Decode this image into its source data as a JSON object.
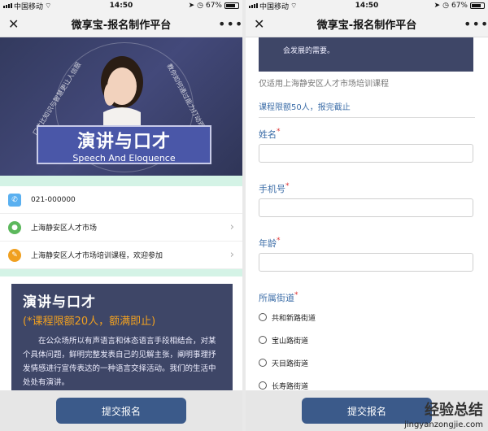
{
  "status": {
    "carrier": "中国移动",
    "time": "14:50",
    "battery": "67%"
  },
  "navbar": {
    "title": "微享宝-报名制作平台",
    "close": "✕",
    "more": "•••"
  },
  "banner": {
    "title_cn": "演讲与口才",
    "title_en": "Speech And Eloquence",
    "arc_left": "口才比知识与智慧更让人信服",
    "arc_right": "教你如何通过能力打动观众"
  },
  "info": [
    {
      "icon": "phone-icon",
      "text": "021-000000",
      "chevron": false,
      "color": "#5ab0f0"
    },
    {
      "icon": "location-icon",
      "text": "上海静安区人才市场",
      "chevron": true,
      "color": "#5cb85c"
    },
    {
      "icon": "pencil-icon",
      "text": "上海静安区人才市场培训课程，欢迎参加",
      "chevron": true,
      "color": "#f0a020"
    }
  ],
  "course": {
    "title": "演讲与口才",
    "limit": "(*课程限额20人，额满即止)",
    "desc": "在公众场所以有声语言和体态语言手段相结合，对某个具体问题，鲜明完整发表自己的见解主张，阐明事理抒发情感进行宣传表达的一种语言交择活动。我们的生活中处处有演讲。"
  },
  "submit_label": "提交报名",
  "form": {
    "card_tail": "会发展的需要。",
    "note": "仅适用上海静安区人才市场培训课程",
    "quota": "课程限额50人，报完截止",
    "name_label": "姓名",
    "phone_label": "手机号",
    "age_label": "年龄",
    "street_label": "所属街道",
    "required_mark": "*",
    "streets": [
      "共和新路街道",
      "宝山路街道",
      "天目路街道",
      "长寿路街道"
    ]
  },
  "watermark": {
    "text": "经验总结",
    "url": "jingyanzongjie.com"
  }
}
